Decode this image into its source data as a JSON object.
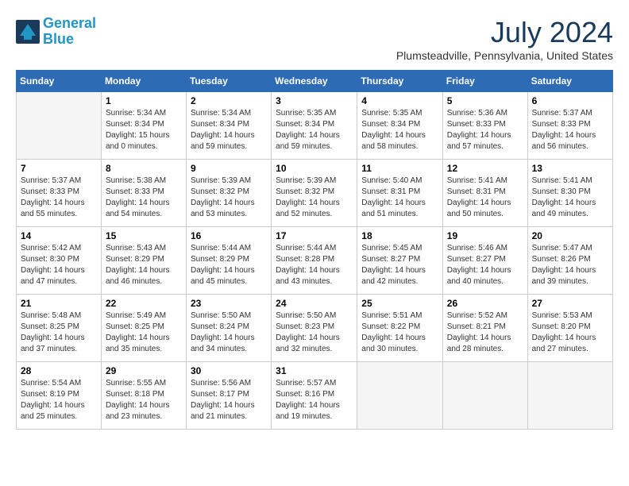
{
  "header": {
    "logo_line1": "General",
    "logo_line2": "Blue",
    "month": "July 2024",
    "location": "Plumsteadville, Pennsylvania, United States"
  },
  "weekdays": [
    "Sunday",
    "Monday",
    "Tuesday",
    "Wednesday",
    "Thursday",
    "Friday",
    "Saturday"
  ],
  "weeks": [
    [
      {
        "day": "",
        "empty": true
      },
      {
        "day": "1",
        "sunrise": "Sunrise: 5:34 AM",
        "sunset": "Sunset: 8:34 PM",
        "daylight": "Daylight: 15 hours and 0 minutes."
      },
      {
        "day": "2",
        "sunrise": "Sunrise: 5:34 AM",
        "sunset": "Sunset: 8:34 PM",
        "daylight": "Daylight: 14 hours and 59 minutes."
      },
      {
        "day": "3",
        "sunrise": "Sunrise: 5:35 AM",
        "sunset": "Sunset: 8:34 PM",
        "daylight": "Daylight: 14 hours and 59 minutes."
      },
      {
        "day": "4",
        "sunrise": "Sunrise: 5:35 AM",
        "sunset": "Sunset: 8:34 PM",
        "daylight": "Daylight: 14 hours and 58 minutes."
      },
      {
        "day": "5",
        "sunrise": "Sunrise: 5:36 AM",
        "sunset": "Sunset: 8:33 PM",
        "daylight": "Daylight: 14 hours and 57 minutes."
      },
      {
        "day": "6",
        "sunrise": "Sunrise: 5:37 AM",
        "sunset": "Sunset: 8:33 PM",
        "daylight": "Daylight: 14 hours and 56 minutes."
      }
    ],
    [
      {
        "day": "7",
        "sunrise": "Sunrise: 5:37 AM",
        "sunset": "Sunset: 8:33 PM",
        "daylight": "Daylight: 14 hours and 55 minutes."
      },
      {
        "day": "8",
        "sunrise": "Sunrise: 5:38 AM",
        "sunset": "Sunset: 8:33 PM",
        "daylight": "Daylight: 14 hours and 54 minutes."
      },
      {
        "day": "9",
        "sunrise": "Sunrise: 5:39 AM",
        "sunset": "Sunset: 8:32 PM",
        "daylight": "Daylight: 14 hours and 53 minutes."
      },
      {
        "day": "10",
        "sunrise": "Sunrise: 5:39 AM",
        "sunset": "Sunset: 8:32 PM",
        "daylight": "Daylight: 14 hours and 52 minutes."
      },
      {
        "day": "11",
        "sunrise": "Sunrise: 5:40 AM",
        "sunset": "Sunset: 8:31 PM",
        "daylight": "Daylight: 14 hours and 51 minutes."
      },
      {
        "day": "12",
        "sunrise": "Sunrise: 5:41 AM",
        "sunset": "Sunset: 8:31 PM",
        "daylight": "Daylight: 14 hours and 50 minutes."
      },
      {
        "day": "13",
        "sunrise": "Sunrise: 5:41 AM",
        "sunset": "Sunset: 8:30 PM",
        "daylight": "Daylight: 14 hours and 49 minutes."
      }
    ],
    [
      {
        "day": "14",
        "sunrise": "Sunrise: 5:42 AM",
        "sunset": "Sunset: 8:30 PM",
        "daylight": "Daylight: 14 hours and 47 minutes."
      },
      {
        "day": "15",
        "sunrise": "Sunrise: 5:43 AM",
        "sunset": "Sunset: 8:29 PM",
        "daylight": "Daylight: 14 hours and 46 minutes."
      },
      {
        "day": "16",
        "sunrise": "Sunrise: 5:44 AM",
        "sunset": "Sunset: 8:29 PM",
        "daylight": "Daylight: 14 hours and 45 minutes."
      },
      {
        "day": "17",
        "sunrise": "Sunrise: 5:44 AM",
        "sunset": "Sunset: 8:28 PM",
        "daylight": "Daylight: 14 hours and 43 minutes."
      },
      {
        "day": "18",
        "sunrise": "Sunrise: 5:45 AM",
        "sunset": "Sunset: 8:27 PM",
        "daylight": "Daylight: 14 hours and 42 minutes."
      },
      {
        "day": "19",
        "sunrise": "Sunrise: 5:46 AM",
        "sunset": "Sunset: 8:27 PM",
        "daylight": "Daylight: 14 hours and 40 minutes."
      },
      {
        "day": "20",
        "sunrise": "Sunrise: 5:47 AM",
        "sunset": "Sunset: 8:26 PM",
        "daylight": "Daylight: 14 hours and 39 minutes."
      }
    ],
    [
      {
        "day": "21",
        "sunrise": "Sunrise: 5:48 AM",
        "sunset": "Sunset: 8:25 PM",
        "daylight": "Daylight: 14 hours and 37 minutes."
      },
      {
        "day": "22",
        "sunrise": "Sunrise: 5:49 AM",
        "sunset": "Sunset: 8:25 PM",
        "daylight": "Daylight: 14 hours and 35 minutes."
      },
      {
        "day": "23",
        "sunrise": "Sunrise: 5:50 AM",
        "sunset": "Sunset: 8:24 PM",
        "daylight": "Daylight: 14 hours and 34 minutes."
      },
      {
        "day": "24",
        "sunrise": "Sunrise: 5:50 AM",
        "sunset": "Sunset: 8:23 PM",
        "daylight": "Daylight: 14 hours and 32 minutes."
      },
      {
        "day": "25",
        "sunrise": "Sunrise: 5:51 AM",
        "sunset": "Sunset: 8:22 PM",
        "daylight": "Daylight: 14 hours and 30 minutes."
      },
      {
        "day": "26",
        "sunrise": "Sunrise: 5:52 AM",
        "sunset": "Sunset: 8:21 PM",
        "daylight": "Daylight: 14 hours and 28 minutes."
      },
      {
        "day": "27",
        "sunrise": "Sunrise: 5:53 AM",
        "sunset": "Sunset: 8:20 PM",
        "daylight": "Daylight: 14 hours and 27 minutes."
      }
    ],
    [
      {
        "day": "28",
        "sunrise": "Sunrise: 5:54 AM",
        "sunset": "Sunset: 8:19 PM",
        "daylight": "Daylight: 14 hours and 25 minutes."
      },
      {
        "day": "29",
        "sunrise": "Sunrise: 5:55 AM",
        "sunset": "Sunset: 8:18 PM",
        "daylight": "Daylight: 14 hours and 23 minutes."
      },
      {
        "day": "30",
        "sunrise": "Sunrise: 5:56 AM",
        "sunset": "Sunset: 8:17 PM",
        "daylight": "Daylight: 14 hours and 21 minutes."
      },
      {
        "day": "31",
        "sunrise": "Sunrise: 5:57 AM",
        "sunset": "Sunset: 8:16 PM",
        "daylight": "Daylight: 14 hours and 19 minutes."
      },
      {
        "day": "",
        "empty": true
      },
      {
        "day": "",
        "empty": true
      },
      {
        "day": "",
        "empty": true
      }
    ]
  ]
}
